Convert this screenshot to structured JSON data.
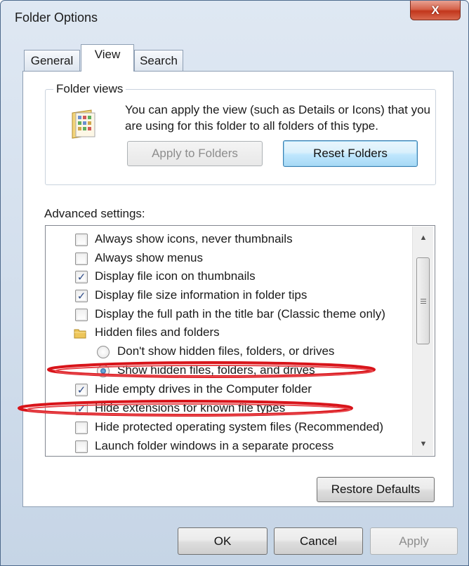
{
  "window": {
    "title": "Folder Options",
    "close_glyph": "X"
  },
  "tabs": [
    {
      "label": "General",
      "active": false
    },
    {
      "label": "View",
      "active": true
    },
    {
      "label": "Search",
      "active": false
    }
  ],
  "folder_views": {
    "group_label": "Folder views",
    "icon": "folder-view-icon",
    "description": "You can apply the view (such as Details or Icons) that you are using for this folder to all folders of this type.",
    "apply_button": "Apply to Folders",
    "reset_button": "Reset Folders"
  },
  "advanced": {
    "label": "Advanced settings:",
    "items": [
      {
        "type": "checkbox",
        "label": "Always show icons, never thumbnails",
        "checked": false
      },
      {
        "type": "checkbox",
        "label": "Always show menus",
        "checked": false
      },
      {
        "type": "checkbox",
        "label": "Display file icon on thumbnails",
        "checked": true
      },
      {
        "type": "checkbox",
        "label": "Display file size information in folder tips",
        "checked": true
      },
      {
        "type": "checkbox",
        "label": "Display the full path in the title bar (Classic theme only)",
        "checked": false
      },
      {
        "type": "folder",
        "label": "Hidden files and folders",
        "icon": "folder-icon"
      },
      {
        "type": "radio",
        "label": "Don't show hidden files, folders, or drives",
        "checked": false
      },
      {
        "type": "radio",
        "label": "Show hidden files, folders, and drives",
        "checked": true
      },
      {
        "type": "checkbox",
        "label": "Hide empty drives in the Computer folder",
        "checked": true
      },
      {
        "type": "checkbox",
        "label": "Hide extensions for known file types",
        "checked": true
      },
      {
        "type": "checkbox",
        "label": "Hide protected operating system files (Recommended)",
        "checked": false
      },
      {
        "type": "checkbox",
        "label": "Launch folder windows in a separate process",
        "checked": false
      }
    ],
    "restore_button": "Restore Defaults"
  },
  "footer": {
    "ok": "OK",
    "cancel": "Cancel",
    "apply": "Apply"
  },
  "annotation_color": "#d8141a",
  "check_glyph": "✓"
}
